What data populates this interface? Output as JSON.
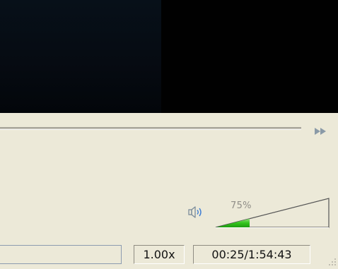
{
  "video": {
    "background": "#010101"
  },
  "seekbar": {
    "fast_forward_icon": "fast-forward-icon"
  },
  "volume": {
    "speaker_icon": "speaker-icon",
    "level": 0.75,
    "percent_label": "75%",
    "fill_color": "#33c41c"
  },
  "status": {
    "playback_rate": "1.00x",
    "time": "00:25/1:54:43"
  },
  "colors": {
    "panel": "#ece9d8",
    "accent_icon": "#8a9aa7"
  }
}
